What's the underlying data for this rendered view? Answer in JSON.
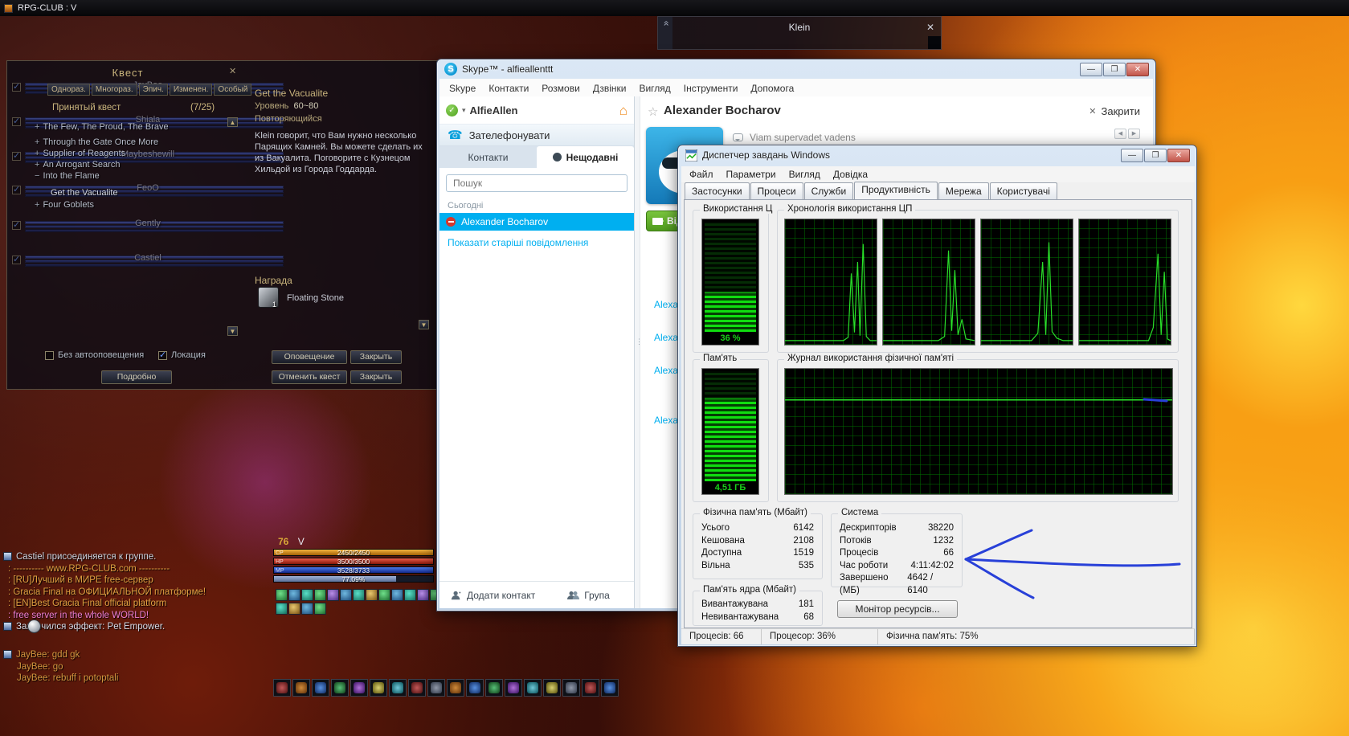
{
  "desktop": {
    "top_title": "RPG-CLUB : V"
  },
  "klein": {
    "title": "Klein",
    "close_glyph": "✕"
  },
  "quest": {
    "title": "Квест",
    "close_glyph": "✕",
    "tabs": [
      "Однораз.",
      "Многораз.",
      "Эпич.",
      "Изменен.",
      "Особый"
    ],
    "accepted_label": "Принятый квест",
    "accepted_count": "(7/25)",
    "items": [
      {
        "prefix": "+",
        "name": "The Few, The Proud, The Brave"
      },
      {
        "prefix": "+",
        "name": "Through the Gate Once More"
      },
      {
        "prefix": "+",
        "name": "Supplier of Reagents"
      },
      {
        "prefix": "+",
        "name": "An Arrogant Search"
      },
      {
        "prefix": "−",
        "name": "Into the Flame"
      },
      {
        "prefix": "",
        "name": "Get the Vacualite"
      },
      {
        "prefix": "+",
        "name": "Four Goblets"
      }
    ],
    "detail": {
      "title": "Get the Vacualite",
      "level_label": "Уровень",
      "level_value": "60~80",
      "repeat": "Повторяющийся",
      "description": "Klein говорит, что Вам нужно несколько Парящих Камней. Вы можете сделать их из Вакуалита. Поговорите с Кузнецом Хильдой из Города Годдарда.",
      "reward_label": "Награда",
      "reward_item": "Floating Stone",
      "reward_qty": "1"
    },
    "buttons": {
      "notify": "Оповещение",
      "close1": "Закрыть",
      "cancel": "Отменить квест",
      "close2": "Закрыть",
      "details": "Подробно"
    },
    "checkbox_auto": "Без автооповещения",
    "checkbox_loc": "Локация"
  },
  "party": {
    "members": [
      "JayBee",
      "Shiala",
      "Maybeshewill",
      "FeoO",
      "Gently",
      "Castiel"
    ]
  },
  "chat": {
    "lines": [
      {
        "text": "Castiel присоединяется к группе.",
        "color": "#ccd2de"
      },
      {
        "text": ": ---------- www.RPG-CLUB.com ----------",
        "color": "#dfa042"
      },
      {
        "text": ": [RU]Лучший в МИРЕ free-сервер",
        "color": "#dfa042"
      },
      {
        "text": ": Gracia Final на ОФИЦИАЛЬНОЙ платформе!",
        "color": "#dfa042"
      },
      {
        "text": ": [EN]Best Gracia Final official platform",
        "color": "#dfa042"
      },
      {
        "text": ": free server in the whole WORLD!",
        "color": "#ef7fd3"
      },
      {
        "text": "Закончился эффект: Pet Empower.",
        "color": "#d6dae6"
      }
    ],
    "lines2": [
      {
        "text": "JayBee: gdd gk",
        "color": "#d1953f"
      },
      {
        "text": "JayBee: go",
        "color": "#d1953f"
      },
      {
        "text": "JayBee: rebuff i potoptali",
        "color": "#d1953f"
      }
    ]
  },
  "hud": {
    "level": "76",
    "name": "V",
    "bars": [
      {
        "label": "CP",
        "value": "2450/2450"
      },
      {
        "label": "HP",
        "value": "3500/3500"
      },
      {
        "label": "MP",
        "value": "3528/3733"
      },
      {
        "label": "",
        "value": "77.09%"
      }
    ],
    "exp_percent": 77
  },
  "skype": {
    "title": "Skype™ - alfieallenttt",
    "menu": [
      "Skype",
      "Контакти",
      "Розмови",
      "Дзвінки",
      "Вигляд",
      "Інструменти",
      "Допомога"
    ],
    "self_name": "AlfieAllen",
    "call_label": "Зателефонувати",
    "tab_contacts": "Контакти",
    "tab_recent": "Нещодавні",
    "search_placeholder": "Пошук",
    "today_label": "Сьогодні",
    "contact_name": "Alexander Bocharov",
    "older_link": "Показати старіші повідомлення",
    "add_contact": "Додати контакт",
    "group_label": "Група",
    "peer_name": "Alexander Bocharov",
    "close_label": "Закрити",
    "mood": "Viam supervadet vadens",
    "video_partial": "Від",
    "history_names": [
      "Alexand",
      "Alexand",
      "Alexand",
      "Alexand"
    ],
    "accent": "#00aff0"
  },
  "tm": {
    "title": "Диспетчер завдань Windows",
    "menu": [
      "Файл",
      "Параметри",
      "Вигляд",
      "Довідка"
    ],
    "tabs": [
      "Застосунки",
      "Процеси",
      "Служби",
      "Продуктивність",
      "Мережа",
      "Користувачі"
    ],
    "cpu_group": "Використання Ц",
    "cpu_value": "36 %",
    "cpu_percent": 36,
    "cpu_history_group": "Хронологія використання ЦП",
    "mem_group": "Пам'ять",
    "mem_value": "4,51 ГБ",
    "mem_percent": 75,
    "mem_history_group": "Журнал використання фізичної пам'яті",
    "phys": {
      "title": "Фізична пам'ять (Мбайт)",
      "rows": [
        [
          "Усього",
          "6142"
        ],
        [
          "Кешована",
          "2108"
        ],
        [
          "Доступна",
          "1519"
        ],
        [
          "Вільна",
          "535"
        ]
      ]
    },
    "system": {
      "title": "Система",
      "rows": [
        [
          "Дескрипторів",
          "38220"
        ],
        [
          "Потоків",
          "1232"
        ],
        [
          "Процесів",
          "66"
        ],
        [
          "Час роботи",
          "4:11:42:02"
        ],
        [
          "Завершено (МБ)",
          "4642 / 6140"
        ]
      ]
    },
    "kernel": {
      "title": "Пам'ять ядра (Мбайт)",
      "rows": [
        [
          "Вивантажувана",
          "181"
        ],
        [
          "Невивантажувана",
          "68"
        ]
      ]
    },
    "resmon": "Монітор ресурсів...",
    "status": [
      "Процесів: 66",
      "Процесор: 36%",
      "Фізична пам'ять: 75%"
    ]
  }
}
